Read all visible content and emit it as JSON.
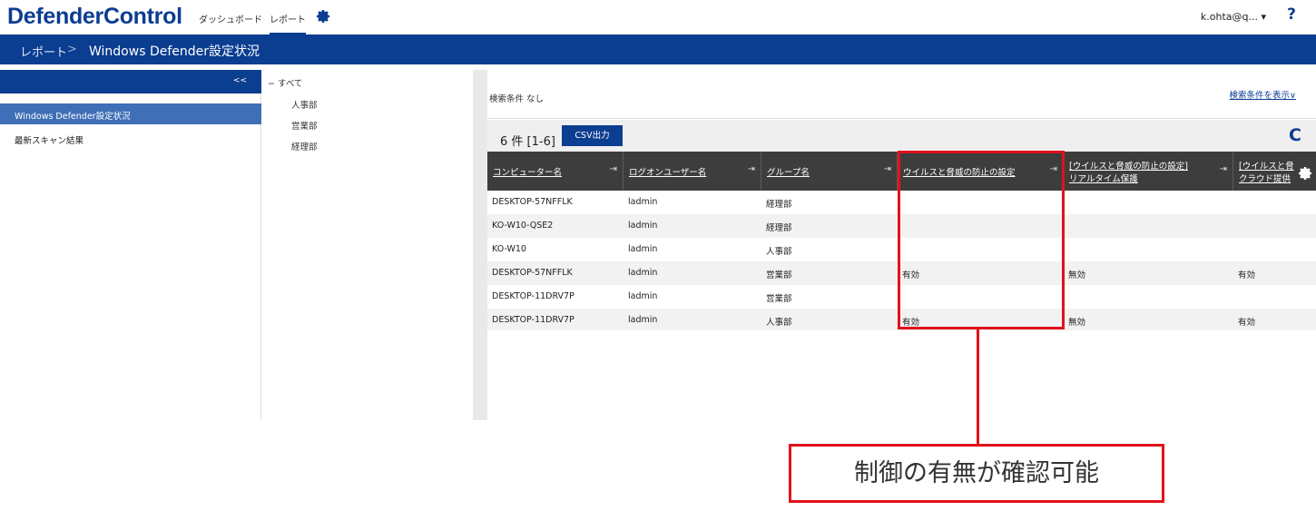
{
  "app": {
    "logo": "DefenderControl",
    "nav": [
      "ダッシュボード",
      "レポート"
    ],
    "user": "k.ohta@q... ▾",
    "help": "?"
  },
  "breadcrumb": {
    "root": "レポート",
    "separator": ">",
    "current": "Windows Defender設定状況"
  },
  "sidebar": {
    "collapse": "<<",
    "items": [
      "Windows Defender設定状況",
      "最新スキャン結果"
    ]
  },
  "tree": {
    "root": "− すべて",
    "children": [
      "人事部",
      "営業部",
      "経理部"
    ]
  },
  "search": {
    "label": "検索条件 なし",
    "toggle": "検索条件を表示∨"
  },
  "grid": {
    "count": "6 件 [1-6]",
    "csv_label": "CSV出力",
    "refresh": "C",
    "columns": [
      {
        "line1": "コンピューター名",
        "line2": ""
      },
      {
        "line1": "ログオンユーザー名",
        "line2": ""
      },
      {
        "line1": "グループ名",
        "line2": ""
      },
      {
        "line1": "ウイルスと脅威の防止の設定",
        "line2": ""
      },
      {
        "line1": "[ウイルスと脅威の防止の設定]",
        "line2": "リアルタイム保護"
      },
      {
        "line1": "[ウイルスと脅",
        "line2": "クラウド提供"
      }
    ],
    "rows": [
      [
        "DESKTOP-57NFFLK",
        "ladmin",
        "経理部",
        "",
        "",
        ""
      ],
      [
        "KO-W10-QSE2",
        "ladmin",
        "経理部",
        "",
        "",
        ""
      ],
      [
        "KO-W10",
        "ladmin",
        "人事部",
        "",
        "",
        ""
      ],
      [
        "DESKTOP-57NFFLK",
        "ladmin",
        "営業部",
        "有効",
        "無効",
        "有効"
      ],
      [
        "DESKTOP-11DRV7P",
        "ladmin",
        "営業部",
        "",
        "",
        ""
      ],
      [
        "DESKTOP-11DRV7P",
        "ladmin",
        "人事部",
        "有効",
        "無効",
        "有効"
      ]
    ]
  },
  "annotation": {
    "callout": "制御の有無が確認可能",
    "color": "#e2111b"
  },
  "colors": {
    "brand": "#0b3d91",
    "header": "#3d3d3d",
    "selected": "#3f6fb7"
  }
}
